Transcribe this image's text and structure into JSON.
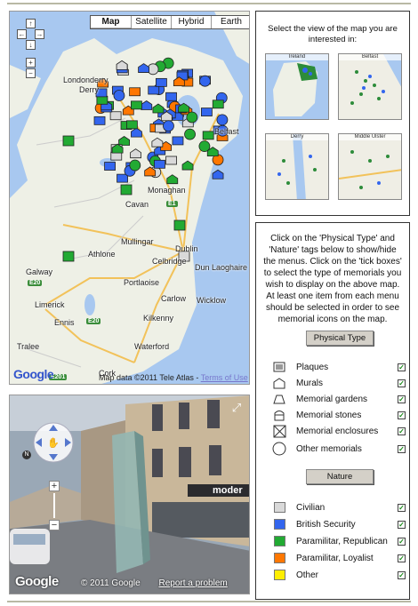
{
  "map": {
    "types": [
      "Map",
      "Satellite",
      "Hybrid",
      "Earth"
    ],
    "active_type": "Map",
    "attribution": "Map data ©2011 Tele Atlas -",
    "terms": "Terms of Use",
    "places": [
      "Londonderry",
      "Derry",
      "Belfast",
      "Dublin",
      "Dun Laoghaire",
      "Galway",
      "Limerick",
      "Cork",
      "Waterford",
      "Athlone",
      "Mullingar",
      "Cavan",
      "Monaghan",
      "Ennis",
      "Celbridge",
      "Wicklow",
      "Kilkenny",
      "Tralee",
      "Portlaoise",
      "Carlow"
    ],
    "roads": [
      "E1",
      "E20",
      "E20",
      "E201"
    ],
    "logo": "Google",
    "colors": {
      "sea": "#a8c8f0",
      "land": "#eef0e6"
    }
  },
  "street_view": {
    "copyright": "© 2011 Google",
    "report": "Report a problem",
    "logo": "Google",
    "shop_sign": "moder"
  },
  "views_panel": {
    "intro": "Select the view of the map you are interested in:",
    "thumbnails": [
      "Ireland",
      "Belfast",
      "Derry",
      "Middle Ulster"
    ]
  },
  "legend": {
    "intro": "Click on the 'Physical Type' and 'Nature' tags below to show/hide the menus. Click on the 'tick boxes' to select the type of memorials you wish to display on the above map. At least one item from each menu should be selected in order to see memorial icons on the map.",
    "physical_tag": "Physical Type",
    "nature_tag": "Nature",
    "physical_items": [
      {
        "label": "Plaques",
        "icon": "plaque-icon",
        "checked": true
      },
      {
        "label": "Murals",
        "icon": "mural-icon",
        "checked": true
      },
      {
        "label": "Memorial gardens",
        "icon": "garden-icon",
        "checked": true
      },
      {
        "label": "Memorial stones",
        "icon": "stone-icon",
        "checked": true
      },
      {
        "label": "Memorial enclosures",
        "icon": "enclosure-icon",
        "checked": true
      },
      {
        "label": "Other memorials",
        "icon": "circle-icon",
        "checked": true
      }
    ],
    "nature_items": [
      {
        "label": "Civilian",
        "color": "#d9d9d9",
        "checked": true
      },
      {
        "label": "British Security",
        "color": "#3366ee",
        "checked": true
      },
      {
        "label": "Paramilitar, Republican",
        "color": "#22aa33",
        "checked": true
      },
      {
        "label": "Paramilitar, Loyalist",
        "color": "#ff7700",
        "checked": true
      },
      {
        "label": "Other",
        "color": "#ffee00",
        "checked": true
      }
    ],
    "check_mark": "✓"
  }
}
